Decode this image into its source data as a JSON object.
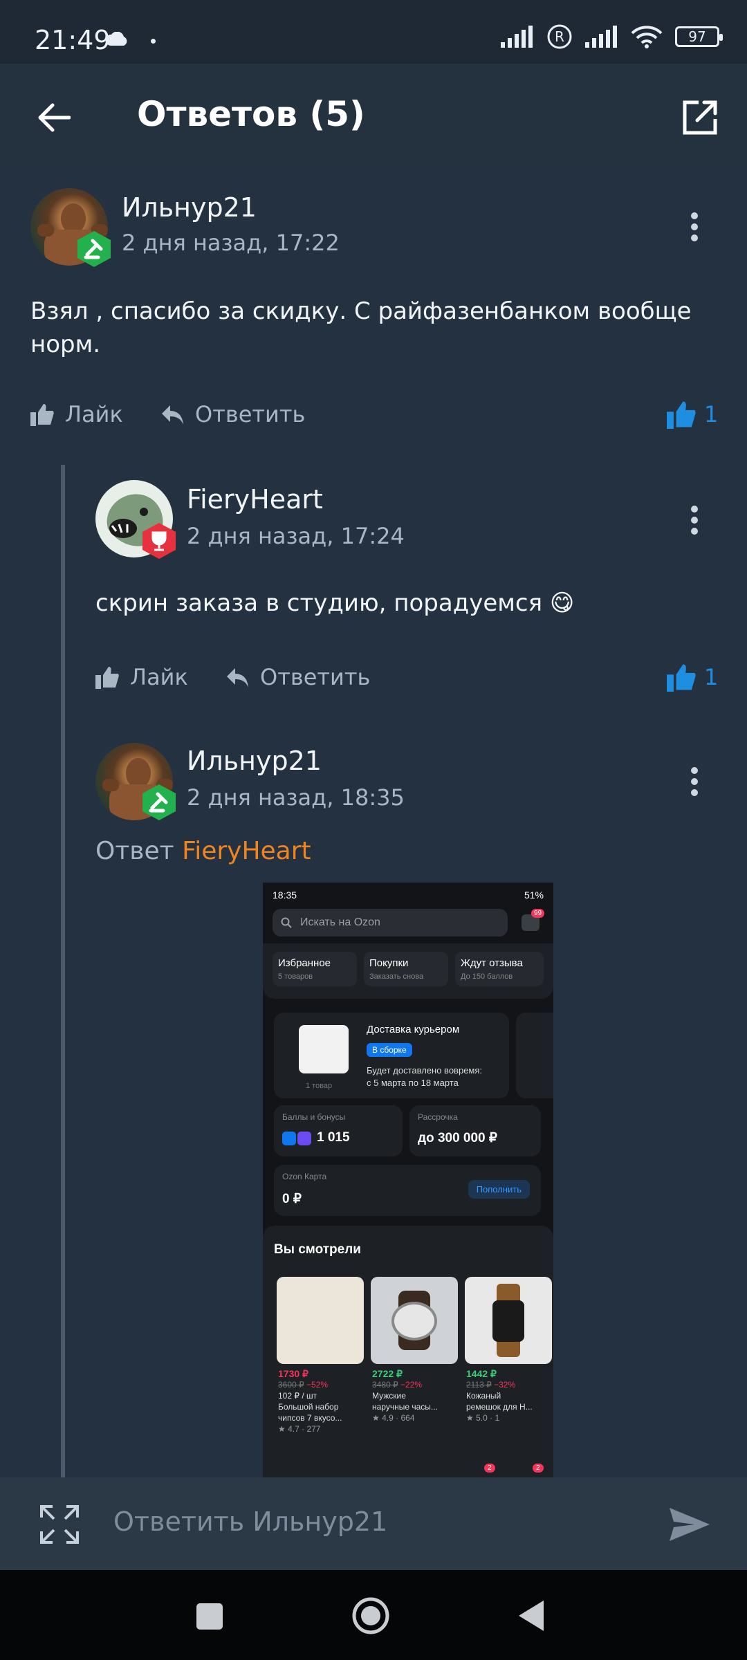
{
  "status": {
    "time": "21:49",
    "battery": "97"
  },
  "header": {
    "title": "Ответов (5)"
  },
  "comments": [
    {
      "author": "Ильнур21",
      "date": "2 дня назад, 17:22",
      "text_line1": "Взял , спасибо за скидку. С райфазенбанком вообще",
      "text_line2": "норм.",
      "like_label": "Лайк",
      "reply_label": "Ответить",
      "likes": "1"
    },
    {
      "author": "FieryHeart",
      "date": "2 дня назад, 17:24",
      "text": "скрин заказа в студию, порадуемся 😋",
      "like_label": "Лайк",
      "reply_label": "Ответить",
      "likes": "1"
    },
    {
      "author": "Ильнур21",
      "date": "2 дня назад, 18:35",
      "reply_prefix": "Ответ",
      "reply_target": "FieryHeart"
    }
  ],
  "screenshot": {
    "time": "18:35",
    "battery": "51%",
    "search_placeholder": "Искать на Ozon",
    "badge": "99",
    "shortcuts": [
      {
        "title": "Избранное",
        "sub": "5 товаров"
      },
      {
        "title": "Покупки",
        "sub": "Заказать снова"
      },
      {
        "title": "Ждут отзыва",
        "sub": "До 150 баллов"
      }
    ],
    "delivery_title": "Доставка курьером",
    "delivery_status": "В сборке",
    "delivery_line1": "Будет доставлено вовремя:",
    "delivery_line2": "с 5 марта по 18 марта",
    "delivery_qty": "1 товар",
    "bonus_label": "Баллы и бонусы",
    "bonus_value": "1 015",
    "installment_label": "Рассрочка",
    "installment_value": "до 300 000 ₽",
    "card_label": "Ozon Карта",
    "card_value": "0 ₽",
    "card_button": "Пополнить",
    "viewed_title": "Вы смотрели",
    "products": [
      {
        "price": "1730 ₽",
        "old": "3600 ₽",
        "disc": "−52%",
        "unit": "102 ₽ / шт",
        "name1": "Большой набор",
        "name2": "чипсов 7 вкусо...",
        "rating": "4.7",
        "reviews": "277"
      },
      {
        "price": "2722 ₽",
        "old": "3480 ₽",
        "disc": "−22%",
        "unit": "",
        "name1": "Мужские",
        "name2": "наручные часы...",
        "rating": "4.9",
        "reviews": "664"
      },
      {
        "price": "1442 ₽",
        "old": "2113 ₽",
        "disc": "−32%",
        "unit": "",
        "name1": "Кожаный",
        "name2": "ремешок для Н...",
        "rating": "5.0",
        "reviews": "1"
      }
    ],
    "nav_badge1": "2",
    "nav_badge2": "2"
  },
  "composer": {
    "placeholder": "Ответить Ильнур21"
  }
}
